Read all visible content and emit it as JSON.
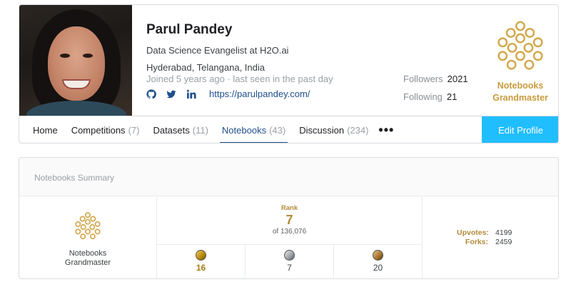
{
  "profile": {
    "name": "Parul Pandey",
    "title": "Data Science Evangelist at H2O.ai",
    "location": "Hyderabad, Telangana, India",
    "joined": "Joined 5 years ago · last seen in the past day",
    "website": "https://parulpandey.com/",
    "social_icons": [
      "github-icon",
      "twitter-icon",
      "linkedin-icon"
    ],
    "followers_label": "Followers",
    "followers": "2021",
    "following_label": "Following",
    "following": "21",
    "tier_line1": "Notebooks",
    "tier_line2": "Grandmaster"
  },
  "nav": {
    "home": "Home",
    "competitions": "Competitions",
    "competitions_count": "(7)",
    "datasets": "Datasets",
    "datasets_count": "(11)",
    "notebooks": "Notebooks",
    "notebooks_count": "(43)",
    "discussion": "Discussion",
    "discussion_count": "(234)",
    "more": "•••",
    "edit_profile": "Edit Profile"
  },
  "summary": {
    "title": "Notebooks Summary",
    "tier_line1": "Notebooks",
    "tier_line2": "Grandmaster",
    "rank_label": "Rank",
    "rank": "7",
    "rank_of": "of 136,076",
    "medals": {
      "gold": "16",
      "silver": "7",
      "bronze": "20"
    },
    "upvotes_label": "Upvotes:",
    "upvotes": "4199",
    "forks_label": "Forks:",
    "forks": "2459"
  },
  "colors": {
    "accent": "#20beff",
    "link": "#1f4e8c",
    "gold": "#c89b3c"
  }
}
